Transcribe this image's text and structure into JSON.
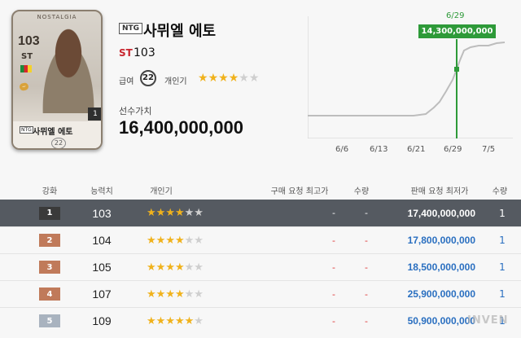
{
  "card": {
    "brand": "NOSTALGIA",
    "ovr": "103",
    "position": "ST",
    "level": "1",
    "season_badge": "NTG",
    "name": "사뮈엘 에토",
    "pay": "22"
  },
  "info": {
    "season_badge": "NTG",
    "name": "사뮈엘 에토",
    "position": "ST",
    "ovr": "103",
    "pay_label": "급여",
    "pay": "22",
    "popularity_label": "개인기",
    "popularity_stars": 4,
    "popularity_max": 6,
    "value_label": "선수가치",
    "value": "16,400,000,000"
  },
  "graph": {
    "tooltip_date": "6/29",
    "tooltip_value": "14,300,000,000",
    "dates": [
      "6/6",
      "6/13",
      "6/21",
      "6/29",
      "7/5"
    ],
    "accent_color": "#2e9a39"
  },
  "table": {
    "headers": {
      "level": "강화",
      "ovr": "능력치",
      "skill": "개인기",
      "buy_price": "구매 요청 최고가",
      "buy_qty": "수량",
      "sell_price": "판매 요청 최저가",
      "sell_qty": "수량"
    },
    "rows": [
      {
        "level": "1",
        "ovr": "103",
        "stars": 4,
        "buy_price": "-",
        "buy_qty": "-",
        "sell_price": "17,400,000,000",
        "sell_qty": "1",
        "level_color": "#3a3a3a"
      },
      {
        "level": "2",
        "ovr": "104",
        "stars": 4,
        "buy_price": "-",
        "buy_qty": "-",
        "sell_price": "17,800,000,000",
        "sell_qty": "1",
        "level_color": "#c07a5a"
      },
      {
        "level": "3",
        "ovr": "105",
        "stars": 4,
        "buy_price": "-",
        "buy_qty": "-",
        "sell_price": "18,500,000,000",
        "sell_qty": "1",
        "level_color": "#c07a5a"
      },
      {
        "level": "4",
        "ovr": "107",
        "stars": 4,
        "buy_price": "-",
        "buy_qty": "-",
        "sell_price": "25,900,000,000",
        "sell_qty": "1",
        "level_color": "#c07a5a"
      },
      {
        "level": "5",
        "ovr": "109",
        "stars": 5,
        "buy_price": "-",
        "buy_qty": "-",
        "sell_price": "50,900,000,000",
        "sell_qty": "1",
        "level_color": "#a9b3bf"
      }
    ]
  },
  "watermark": "INVEN"
}
